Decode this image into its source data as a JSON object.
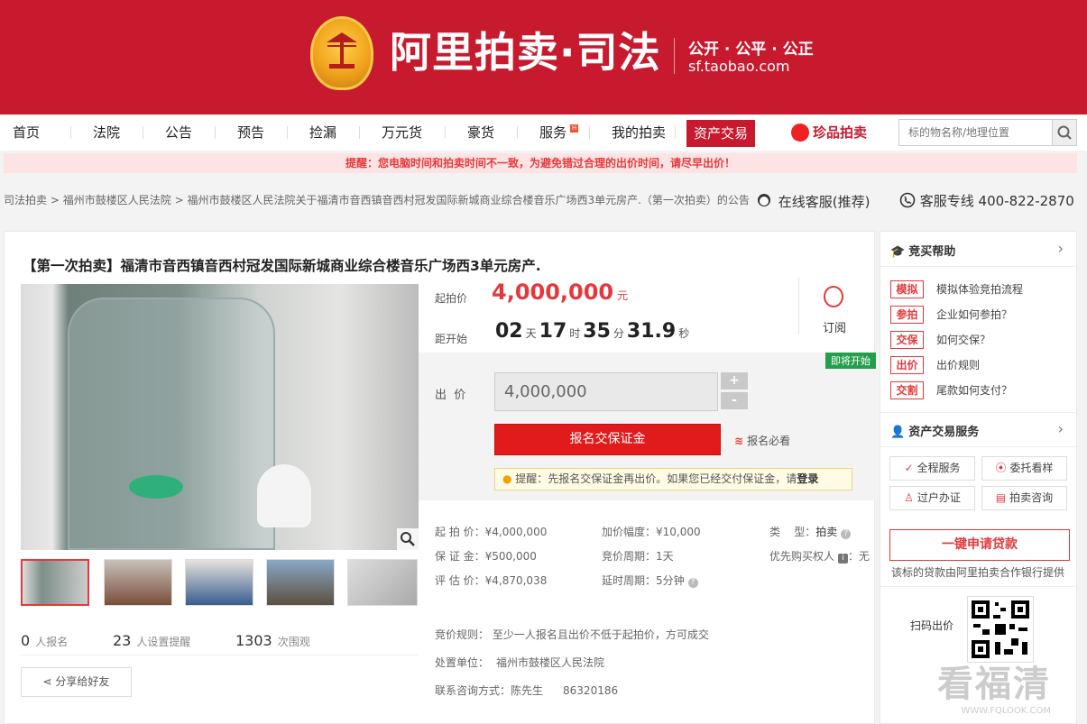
{
  "header": {
    "brand": "阿里拍卖·司法",
    "tagline1": "公开 · 公平 · 公正",
    "tagline2": "sf.taobao.com"
  },
  "nav": {
    "items": [
      "首页",
      "法院",
      "公告",
      "预告",
      "捡漏",
      "万元货",
      "豪货",
      "服务",
      "我的拍卖"
    ],
    "service_badge": "H",
    "asset_trade": "资产交易",
    "treasure": "珍品拍卖",
    "search_placeholder": "标的物名称/地理位置"
  },
  "warning": "提醒：您电脑时间和拍卖时间不一致，为避免错过合理的出价时间，请尽早出价！",
  "breadcrumb": {
    "c1": "司法拍卖",
    "c2": "福州市鼓楼区人民法院",
    "c3": "福州市鼓楼区人民法院关于福清市音西镇音西村冠发国际新城商业综合楼音乐广场西3单元房产.（第一次拍卖）的公告",
    "sep": ">"
  },
  "service": {
    "online": "在线客服(推荐)",
    "hotline": "客服专线 400-822-2870"
  },
  "item": {
    "title": "【第一次拍卖】福清市音西镇音西村冠发国际新城商业综合楼音乐广场西3单元房产.",
    "start_price_label": "起拍价",
    "start_price": "4,000,000",
    "currency": "元",
    "countdown_label": "距开始",
    "countdown": {
      "days": "02",
      "days_unit": "天",
      "hours": "17",
      "hours_unit": "时",
      "minutes": "35",
      "minutes_unit": "分",
      "seconds": "31.9",
      "seconds_unit": "秒"
    },
    "subscribe": "订阅",
    "soon_badge": "即将开始",
    "bid_label": "出  价",
    "bid_value": "4,000,000",
    "plus": "+",
    "minus": "-",
    "register_button": "报名交保证金",
    "register_must_read": "报名必看",
    "tip": "提醒：先报名交保证金再出价。如果您已经交付保证金，请",
    "tip_login": "登录"
  },
  "details": {
    "start_price": "起 拍 价：¥4,000,000",
    "deposit": "保 证 金：¥500,000",
    "appraisal": "评 估 价：¥4,870,038",
    "increment": "加价幅度：¥10,000",
    "cycle": "竞价周期：1天",
    "delay": "延时周期：5分钟",
    "type_label": "类    型：",
    "type_value": "拍卖",
    "priority": "优先购买权人",
    "priority_value": "：无",
    "rule": "竞价规则：  至少一人报名且出价不低于起拍价，方可成交",
    "unit_label": "处置单位：",
    "unit_value": "福州市鼓楼区人民法院",
    "contact_label": "联系咨询方式：",
    "contact_name": "陈先生",
    "contact_phone": "86320186"
  },
  "stats": {
    "signups": "0",
    "signups_label": "人报名",
    "reminders": "23",
    "reminders_label": "人设置提醒",
    "views": "1303",
    "views_label": "次围观"
  },
  "share": "分享给好友",
  "side": {
    "help_title": "竞买帮助",
    "help": [
      {
        "tag": "模拟",
        "text": "模拟体验竞拍流程"
      },
      {
        "tag": "参拍",
        "text": "企业如何参拍？"
      },
      {
        "tag": "交保",
        "text": "如何交保？"
      },
      {
        "tag": "出价",
        "text": "出价规则"
      },
      {
        "tag": "交割",
        "text": "尾款如何支付？"
      }
    ],
    "asset_title": "资产交易服务",
    "svc": [
      "全程服务",
      "委托看样",
      "过户办证",
      "拍卖咨询"
    ],
    "loan": "一键申请贷款",
    "loan_note": "该标的贷款由阿里拍卖合作银行提供",
    "scan": "扫码出价"
  },
  "watermark": {
    "text": "看福清",
    "url": "WWW.FQLOOK.COM"
  },
  "colors": {
    "brand_red": "#c71a2e",
    "accent": "#e4393c",
    "soon_green": "#22a04b"
  }
}
